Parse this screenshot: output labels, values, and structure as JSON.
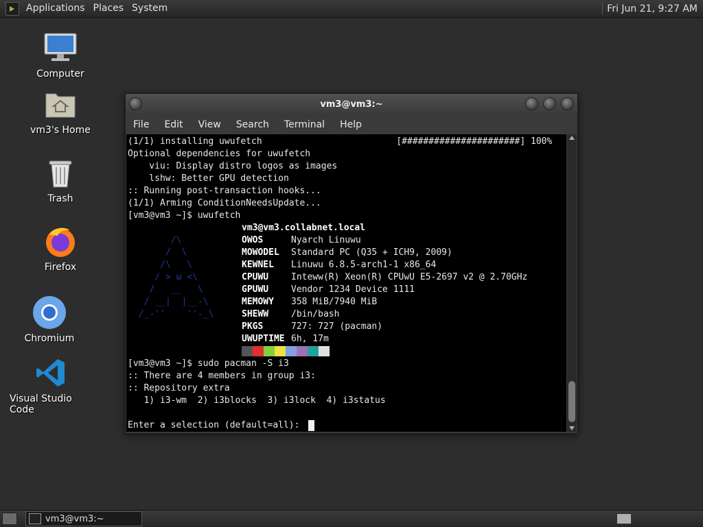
{
  "top_panel": {
    "menus": [
      "Applications",
      "Places",
      "System"
    ],
    "clock": "Fri Jun 21,  9:27 AM"
  },
  "desktop_icons": [
    {
      "label": "Computer",
      "icon": "computer-icon"
    },
    {
      "label": "vm3's Home",
      "icon": "home-folder-icon"
    },
    {
      "label": "Trash",
      "icon": "trash-icon"
    },
    {
      "label": "Firefox",
      "icon": "firefox-icon"
    },
    {
      "label": "Chromium",
      "icon": "chromium-icon"
    },
    {
      "label": "Visual Studio Code",
      "icon": "vscode-icon"
    }
  ],
  "terminal": {
    "title": "vm3@vm3:~",
    "menu": [
      "File",
      "Edit",
      "View",
      "Search",
      "Terminal",
      "Help"
    ],
    "lines_top": [
      "(1/1) installing uwufetch                         [######################] 100%",
      "Optional dependencies for uwufetch",
      "    viu: Display distro logos as images",
      "    lshw: Better GPU detection",
      ":: Running post-transaction hooks...",
      "(1/1) Arming ConditionNeedsUpdate...",
      "[vm3@vm3 ~]$ uwufetch"
    ],
    "fetch_header": "vm3@vm3.collabnet.local",
    "fetch": [
      {
        "key": "OWOS",
        "value": "Nyarch Linuwu"
      },
      {
        "key": "MOWODEL",
        "value": "Standard PC (Q35 + ICH9, 2009)"
      },
      {
        "key": "KEWNEL",
        "value": "Linuwu 6.8.5-arch1-1 x86_64"
      },
      {
        "key": "CPUWU",
        "value": "Inteww(R) Xeon(R) CPUwU E5-2697 v2 @ 2.70GHz"
      },
      {
        "key": "GPUWU",
        "value": "Vendor 1234 Device 1111"
      },
      {
        "key": "MEMOWY",
        "value": "358 MiB/7940 MiB"
      },
      {
        "key": "SHEWW",
        "value": "/bin/bash"
      },
      {
        "key": "PKGS",
        "value": "727: 727 (pacman)"
      },
      {
        "key": "UWUPTIME",
        "value": "6h, 17m"
      }
    ],
    "logo": [
      "       /\\",
      "      /  \\",
      "     /\\   \\",
      "    / > ω <\\",
      "   /   __   \\",
      "  / __|  |__-\\",
      " /_-''    ''-_\\"
    ],
    "palette": [
      "#555555",
      "#e03030",
      "#80d040",
      "#f0e040",
      "#80a0e0",
      "#a070b0",
      "#20a0a0",
      "#e0e0e0"
    ],
    "lines_bottom": [
      "[vm3@vm3 ~]$ sudo pacman -S i3",
      ":: There are 4 members in group i3:",
      ":: Repository extra",
      "   1) i3-wm  2) i3blocks  3) i3lock  4) i3status",
      "",
      "Enter a selection (default=all): "
    ]
  },
  "taskbar": {
    "task_label": "vm3@vm3:~"
  }
}
